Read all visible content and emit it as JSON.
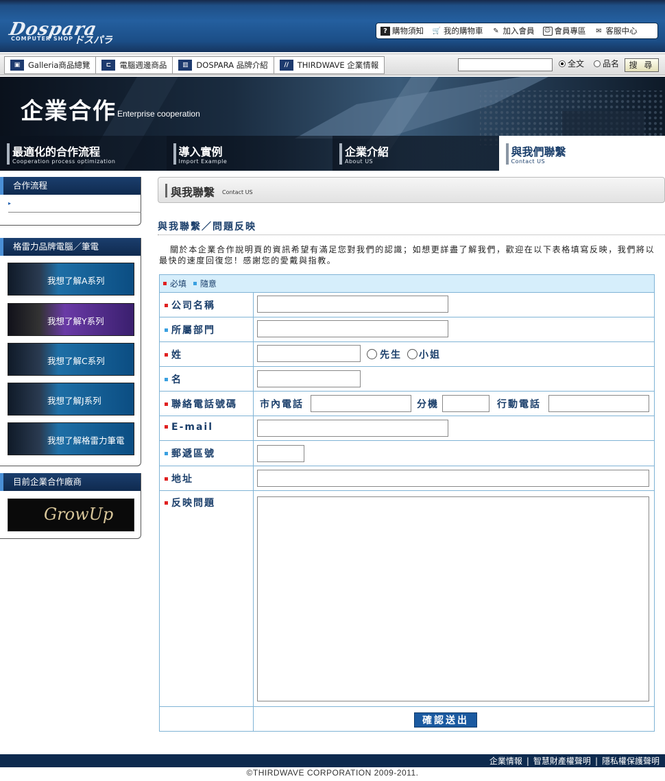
{
  "header": {
    "logo_text": "Dospara",
    "logo_sub": "COMPUTER SHOP",
    "logo_kana": "ドスパラ",
    "menu": [
      {
        "label": "購物須知",
        "icon": "question-icon",
        "glyph": "?"
      },
      {
        "label": "我的購物車",
        "icon": "cart-icon",
        "glyph": "🛒"
      },
      {
        "label": "加入會員",
        "icon": "edit-icon",
        "glyph": "✎"
      },
      {
        "label": "會員專區",
        "icon": "member-icon",
        "glyph": "☺"
      },
      {
        "label": "客服中心",
        "icon": "mail-icon",
        "glyph": "✉"
      }
    ]
  },
  "nav": {
    "tabs": [
      {
        "label": "Galleria商品總覽",
        "icon": "gamepad-icon",
        "glyph": "▣"
      },
      {
        "label": "電腦週邊商品",
        "icon": "plug-icon",
        "glyph": "⊏"
      },
      {
        "label": "DOSPARA 品牌介紹",
        "icon": "building-icon",
        "glyph": "▥"
      },
      {
        "label": "THIRDWAVE 企業情報",
        "icon": "wave-icon",
        "glyph": "//"
      }
    ],
    "search": {
      "value": "",
      "radio_all": "全文",
      "radio_name": "品名",
      "button": "搜 尋"
    }
  },
  "banner": {
    "title": "企業合作",
    "subtitle": "Enterprise cooperation",
    "tabs": [
      {
        "title": "最適化的合作流程",
        "sub": "Cooperation process optimization"
      },
      {
        "title": "導入實例",
        "sub": "Import Example"
      },
      {
        "title": "企業介紹",
        "sub": "About US"
      },
      {
        "title": "與我們聯繫",
        "sub": "Contact US"
      }
    ]
  },
  "sidebar": {
    "flow_title": "合作流程",
    "flow_item": "▸",
    "brand_title": "格雷力品牌電腦／筆電",
    "brands": [
      "我想了解A系列",
      "我想了解Y系列",
      "我想了解C系列",
      "我想了解J系列",
      "我想了解格雷力筆電"
    ],
    "partner_title": "目前企業合作廠商",
    "partner_logo": "GrowUp"
  },
  "main": {
    "crumb_title": "與我聯繫",
    "crumb_sub": "Contact US",
    "section_title": "與我聯繫／問題反映",
    "intro": "關於本企業合作說明頁的資訊希望有滿足您對我們的認識；如想更詳盡了解我們，歡迎在以下表格填寫反映，我們將以最快的速度回復您！感謝您的愛戴與指教。"
  },
  "form": {
    "legend_required": "必填",
    "legend_optional": "隨意",
    "colors": {
      "required": "#e02020",
      "optional": "#3aa0e0"
    },
    "fields": {
      "company": "公司名稱",
      "department": "所屬部門",
      "last_name": "姓",
      "mr": "先生",
      "ms": "小姐",
      "first_name": "名",
      "phone": "聯絡電話號碼",
      "local_phone": "市內電話",
      "ext": "分機",
      "mobile": "行動電話",
      "email": "E-mail",
      "zip": "郵遞區號",
      "address": "地址",
      "issue": "反映問題"
    },
    "submit": "確認送出"
  },
  "footer": {
    "links": [
      "企業情報",
      "智慧財產權聲明",
      "隱私權保護聲明"
    ],
    "copyright": "©THIRDWAVE CORPORATION 2009-2011."
  }
}
